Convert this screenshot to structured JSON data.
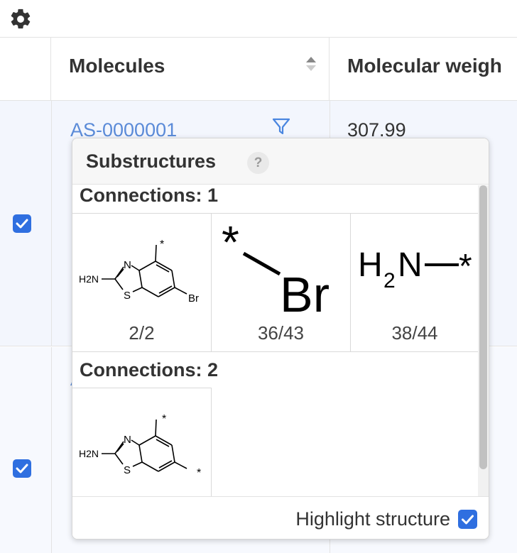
{
  "toolbar": {
    "settings_icon": "gear-icon"
  },
  "table": {
    "columns": [
      {
        "label": ""
      },
      {
        "label": "Molecules",
        "sort_icon": "sort-icon"
      },
      {
        "label": "Molecular weigh"
      }
    ],
    "rows": [
      {
        "checked": true,
        "molecule_id": "AS-0000001",
        "molecular_weight": "307.99",
        "filter_icon": "filter-icon"
      },
      {
        "checked": true,
        "molecule_id": "A",
        "molecular_weight": ""
      }
    ]
  },
  "popup": {
    "title": "Substructures",
    "help_label": "?",
    "groups": [
      {
        "title": "Connections: 1",
        "items": [
          {
            "structure": "aminobenzothiazole-bromo-star",
            "label": "2/2",
            "atoms": {
              "h2n": "H2N",
              "n": "N",
              "s": "S",
              "br": "Br",
              "star": "*"
            }
          },
          {
            "structure": "star-bromine",
            "label": "36/43",
            "atoms": {
              "star": "*",
              "br": "Br"
            }
          },
          {
            "structure": "amine-star",
            "label": "38/44",
            "atoms": {
              "h": "H",
              "sub": "2",
              "n": "N",
              "star": "*"
            }
          }
        ]
      },
      {
        "title": "Connections: 2",
        "items": [
          {
            "structure": "aminobenzothiazole-two-stars",
            "label": "",
            "atoms": {
              "h2n": "H2N",
              "n": "N",
              "s": "S",
              "star1": "*",
              "star2": "*"
            }
          }
        ]
      }
    ],
    "footer": {
      "highlight_label": "Highlight structure",
      "highlight_checked": true
    }
  },
  "colors": {
    "accent": "#2f6fe0",
    "link": "#5b8bd8",
    "row_bg": "#f3f6fd"
  }
}
